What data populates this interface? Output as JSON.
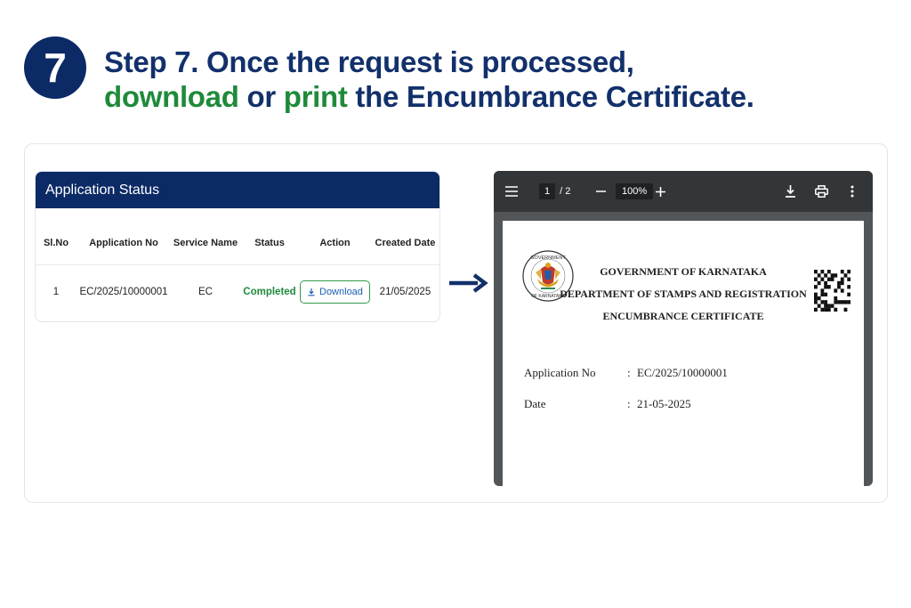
{
  "step": {
    "number": "7",
    "line1": "Step 7. Once the request is processed,",
    "line2_word1": "download",
    "line2_or": " or ",
    "line2_word2": "print",
    "line2_rest": " the Encumbrance Certificate."
  },
  "application_status": {
    "title": "Application Status",
    "columns": [
      "Sl.No",
      "Application No",
      "Service Name",
      "Status",
      "Action",
      "Created Date"
    ],
    "rows": [
      {
        "sl_no": "1",
        "application_no": "EC/2025/10000001",
        "service_name": "EC",
        "status": "Completed",
        "action_label": "Download",
        "created_date": "21/05/2025"
      }
    ]
  },
  "viewer": {
    "page_current": "1",
    "page_total": "/ 2",
    "zoom": "100%",
    "icons": [
      "menu-icon",
      "zoom-out-icon",
      "zoom-in-icon",
      "download-icon",
      "print-icon",
      "more-icon"
    ]
  },
  "certificate": {
    "line1": "GOVERNMENT OF KARNATAKA",
    "line2": "DEPARTMENT OF STAMPS AND REGISTRATION",
    "line3": "ENCUMBRANCE CERTIFICATE",
    "emblem_text_top": "GOVERNMENT",
    "emblem_text_bottom": "OF KARNATAKA",
    "fields": [
      {
        "label": "Application No",
        "sep": ":",
        "value": "EC/2025/10000001"
      },
      {
        "label": "Date",
        "sep": ":",
        "value": "21-05-2025"
      }
    ]
  },
  "colors": {
    "navy": "#0b2a66",
    "green": "#1f8a3a",
    "link_blue": "#1a5fb4"
  }
}
